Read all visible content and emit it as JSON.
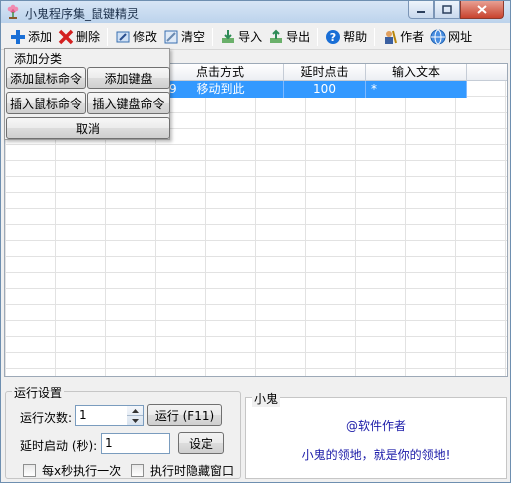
{
  "window": {
    "title": "小鬼程序集_鼠键精灵"
  },
  "toolbar": [
    {
      "label": "添加",
      "icon": "plus-icon",
      "color": "#1a6fd6"
    },
    {
      "label": "删除",
      "icon": "delete-x-icon",
      "color": "#d42020"
    },
    {
      "label": "修改",
      "icon": "edit-icon",
      "color": "#3a6fb0"
    },
    {
      "label": "清空",
      "icon": "clear-icon",
      "color": "#3a6fb0"
    },
    {
      "label": "导入",
      "icon": "import-icon",
      "color": "#2e8b57"
    },
    {
      "label": "导出",
      "icon": "export-icon",
      "color": "#2e8b57"
    },
    {
      "label": "帮助",
      "icon": "help-icon",
      "color": "#1a6fd6"
    },
    {
      "label": "作者",
      "icon": "author-icon",
      "color": "#b8860b"
    },
    {
      "label": "网址",
      "icon": "globe-icon",
      "color": "#1a6fd6"
    }
  ],
  "grid": {
    "columns": [
      "标Y",
      "点击方式",
      "延时点击",
      "输入文本"
    ],
    "selected_row": [
      "9",
      "移动到此",
      "100",
      "*"
    ],
    "selection_color": "#3399ff"
  },
  "popup": {
    "legend": "添加分类",
    "buttons": [
      "添加鼠标命令",
      "添加键盘",
      "插入鼠标命令",
      "插入键盘命令",
      "取消"
    ]
  },
  "run_settings": {
    "legend": "运行设置",
    "run_count_label": "运行次数:",
    "run_count_value": "1",
    "run_button": "运行 (F11)",
    "delay_label": "延时启动 (秒):",
    "delay_value": "1",
    "set_button": "设定",
    "check_every_second": "每x秒执行一次",
    "check_hide_window": "执行时隐藏窗口"
  },
  "info": {
    "legend": "小鬼",
    "author": "@软件作者",
    "slogan": "小鬼的领地，就是你的领地!"
  }
}
